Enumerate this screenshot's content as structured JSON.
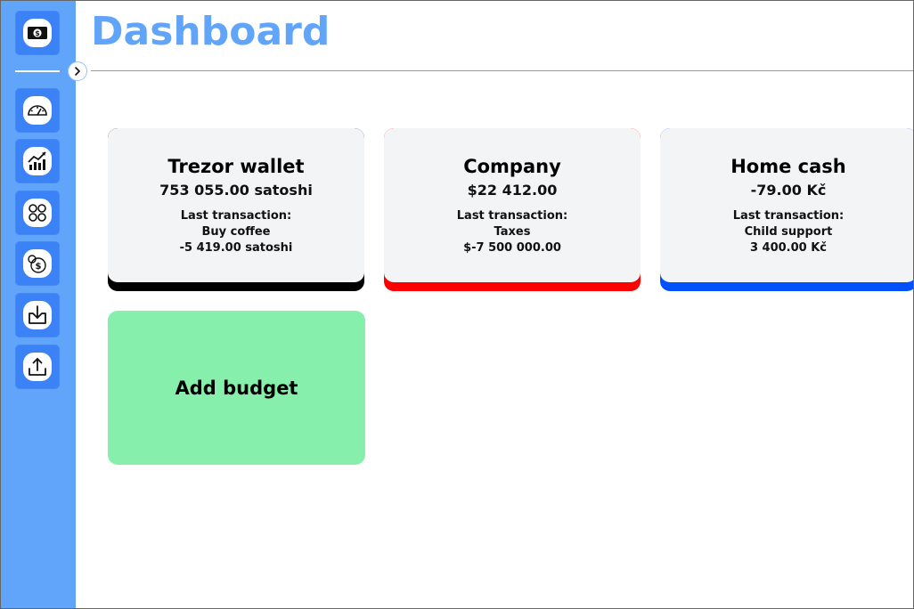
{
  "header": {
    "title": "Dashboard"
  },
  "sidebar": {
    "items": [
      {
        "icon": "money-icon"
      },
      {
        "icon": "gauge-icon"
      },
      {
        "icon": "chart-icon"
      },
      {
        "icon": "apps-icon"
      },
      {
        "icon": "coins-icon"
      },
      {
        "icon": "import-icon"
      },
      {
        "icon": "export-icon"
      }
    ],
    "toggle_icon": "chevron-right-icon"
  },
  "budgets": [
    {
      "name": "Trezor wallet",
      "balance": "753 055.00 satoshi",
      "last_label": "Last transaction:",
      "last_desc": "Buy coffee",
      "last_amount": "-5 419.00 satoshi",
      "color": "#000000"
    },
    {
      "name": "Company",
      "balance": "$22 412.00",
      "last_label": "Last transaction:",
      "last_desc": "Taxes",
      "last_amount": "$-7 500 000.00",
      "color": "#ff0000"
    },
    {
      "name": "Home cash",
      "balance": "-79.00 Kč",
      "last_label": "Last transaction:",
      "last_desc": "Child support",
      "last_amount": "3 400.00 Kč",
      "color": "#0050ff"
    }
  ],
  "add_budget": {
    "label": "Add budget",
    "color": "#86efac"
  },
  "theme": {
    "sidebar": "#60a5fa",
    "sidebar_button": "#3b82f6",
    "title": "#60a5fa",
    "card": "#f3f4f6"
  }
}
